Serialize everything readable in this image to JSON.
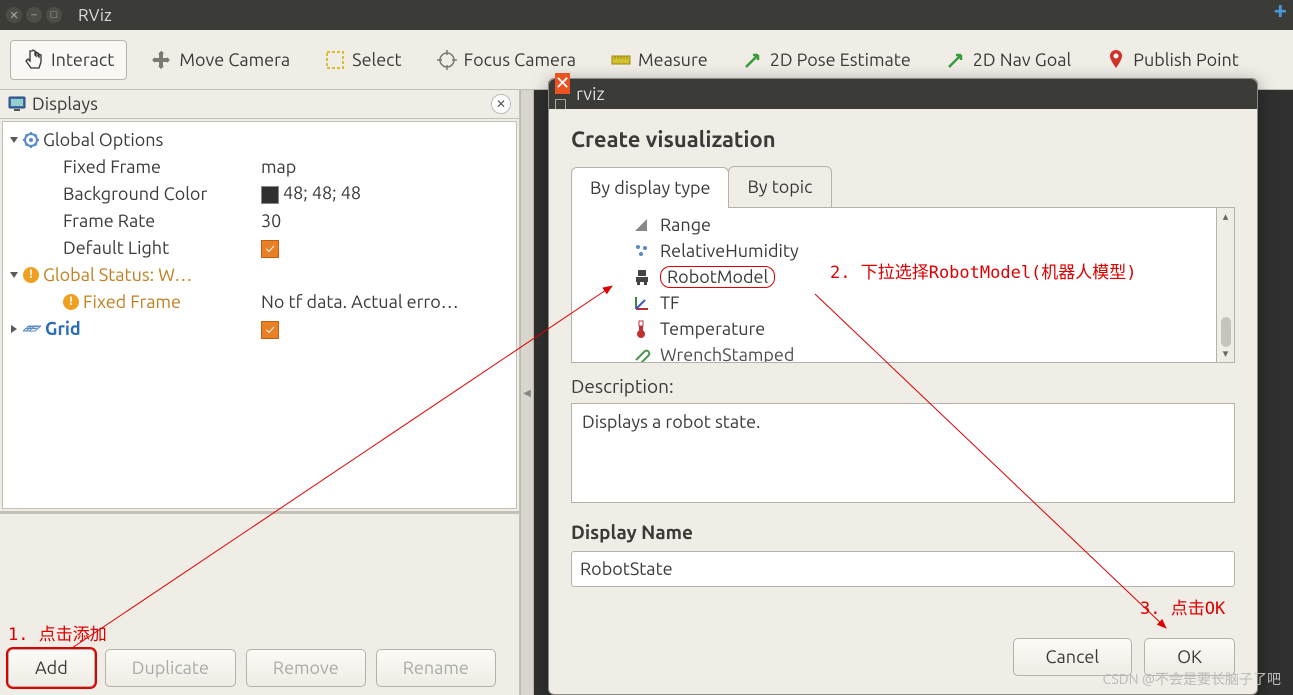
{
  "main_window": {
    "title": "RViz"
  },
  "toolbar": {
    "interact": "Interact",
    "move_camera": "Move Camera",
    "select": "Select",
    "focus_camera": "Focus Camera",
    "measure": "Measure",
    "pose_estimate": "2D Pose Estimate",
    "nav_goal": "2D Nav Goal",
    "publish_point": "Publish Point"
  },
  "displays": {
    "panel_title": "Displays",
    "tree": {
      "global_options": {
        "label": "Global Options",
        "fixed_frame": {
          "label": "Fixed Frame",
          "value": "map"
        },
        "bg_color": {
          "label": "Background Color",
          "value": "48; 48; 48"
        },
        "frame_rate": {
          "label": "Frame Rate",
          "value": "30"
        },
        "default_light": {
          "label": "Default Light"
        }
      },
      "global_status": {
        "label": "Global Status: W…",
        "fixed_frame": {
          "label": "Fixed Frame",
          "value": "No tf data.  Actual erro…"
        }
      },
      "grid": {
        "label": "Grid"
      }
    },
    "buttons": {
      "add": "Add",
      "duplicate": "Duplicate",
      "remove": "Remove",
      "rename": "Rename"
    }
  },
  "dialog": {
    "title": "rviz",
    "heading": "Create visualization",
    "tabs": {
      "by_type": "By display type",
      "by_topic": "By topic"
    },
    "types": {
      "range": "Range",
      "relative_humidity": "RelativeHumidity",
      "robot_model": "RobotModel",
      "tf": "TF",
      "temperature": "Temperature",
      "wrench_stamped": "WrenchStamped"
    },
    "description_label": "Description:",
    "description": "Displays a robot state.",
    "display_name_label": "Display Name",
    "display_name_value": "RobotState",
    "buttons": {
      "cancel": "Cancel",
      "ok": "OK"
    }
  },
  "annotations": {
    "step1": "1. 点击添加",
    "step2": "2. 下拉选择RobotModel(机器人模型)",
    "step3": "3. 点击OK"
  },
  "watermark": "CSDN @不会是要长脑子了吧"
}
